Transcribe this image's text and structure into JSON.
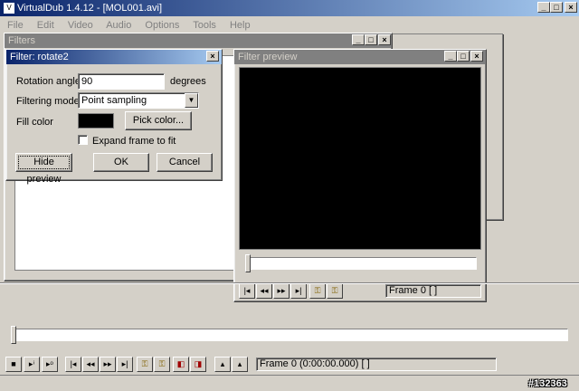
{
  "app": {
    "title": "VirtualDub 1.4.12 - [MOL001.avi]",
    "menu": [
      "File",
      "Edit",
      "Video",
      "Audio",
      "Options",
      "Tools",
      "Help"
    ]
  },
  "filters_window": {
    "title": "Filters"
  },
  "dialog": {
    "title": "Filter: rotate2",
    "rotation_label": "Rotation angle",
    "rotation_value": "90",
    "degrees_label": "degrees",
    "filtering_label": "Filtering mode",
    "filtering_value": "Point sampling",
    "fill_label": "Fill color",
    "pick_color_label": "Pick color...",
    "expand_label": "Expand frame to fit",
    "hide_preview_label": "Hide preview",
    "ok_label": "OK",
    "cancel_label": "Cancel",
    "fill_color": "#000000"
  },
  "preview": {
    "title": "Filter preview",
    "frame_status": "Frame 0 [ ]"
  },
  "main": {
    "frame_status": "Frame 0 (0:00:00.000) [ ]",
    "watermark": "#132363"
  }
}
